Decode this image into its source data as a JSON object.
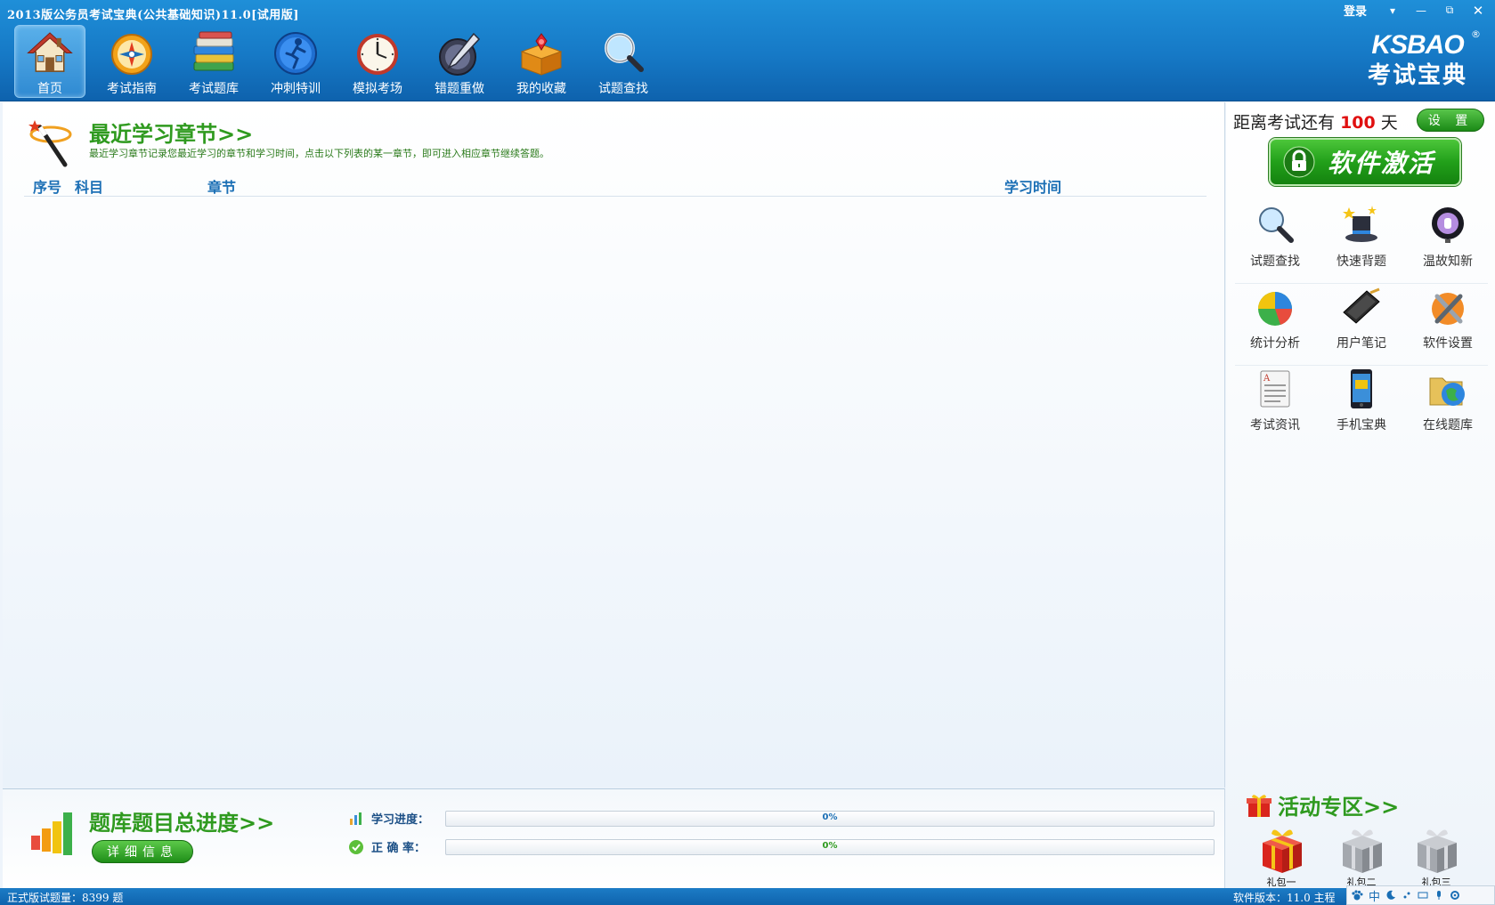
{
  "window": {
    "title": "2013版公务员考试宝典(公共基础知识)11.0[试用版]",
    "login_label": "登录",
    "controls": [
      "▾",
      "—",
      "⧉",
      "✕"
    ]
  },
  "toolbar": {
    "items": [
      {
        "label": "首页",
        "icon": "home-icon",
        "active": true
      },
      {
        "label": "考试指南",
        "icon": "compass-icon"
      },
      {
        "label": "考试题库",
        "icon": "books-icon"
      },
      {
        "label": "冲刺特训",
        "icon": "runner-globe-icon"
      },
      {
        "label": "模拟考场",
        "icon": "clock-icon"
      },
      {
        "label": "错题重做",
        "icon": "pen-icon"
      },
      {
        "label": "我的收藏",
        "icon": "treasure-box-icon"
      },
      {
        "label": "试题查找",
        "icon": "magnifier-icon"
      }
    ]
  },
  "brand": {
    "line1": "KSBAO",
    "line2": "考试宝典",
    "reg": "®"
  },
  "recent": {
    "title": "最近学习章节>>",
    "description": "最近学习章节记录您最近学习的章节和学习时间，点击以下列表的某一章节，即可进入相应章节继续答题。",
    "columns": {
      "index": "序号",
      "subject": "科目",
      "chapter": "章节",
      "time": "学习时间"
    },
    "rows": []
  },
  "progress": {
    "title": "题库题目总进度>>",
    "detail_button": "详细信息",
    "study_label": "学习进度：",
    "study_value": 0,
    "study_text": "0%",
    "accuracy_label": "正 确 率：",
    "accuracy_value": 0,
    "accuracy_text": "0%"
  },
  "sidebar": {
    "countdown_prefix": "距离考试还有",
    "countdown_days": "100",
    "countdown_suffix": "天",
    "settings_button": "设 置",
    "activate_button": "软件激活",
    "tools": [
      {
        "label": "试题查找",
        "icon": "magnifier-icon"
      },
      {
        "label": "快速背题",
        "icon": "magic-hat-icon"
      },
      {
        "label": "温故知新",
        "icon": "lightbulb-icon"
      },
      {
        "label": "统计分析",
        "icon": "pie-chart-icon"
      },
      {
        "label": "用户笔记",
        "icon": "notebook-icon"
      },
      {
        "label": "软件设置",
        "icon": "tools-icon"
      },
      {
        "label": "考试资讯",
        "icon": "document-icon"
      },
      {
        "label": "手机宝典",
        "icon": "phone-icon"
      },
      {
        "label": "在线题库",
        "icon": "globe-folder-icon"
      }
    ],
    "activity_title": "活动专区>>",
    "gifts": [
      "礼包一",
      "礼包二",
      "礼包三"
    ]
  },
  "status": {
    "left": "正式版试题量：8399 题",
    "right": "软件版本：11.0 主程"
  },
  "ime": {
    "lang": "中"
  },
  "colors": {
    "header": "#1679c6",
    "accent_green": "#2f9a1f",
    "days_red": "#e01010",
    "link_blue": "#1b6fb5"
  }
}
